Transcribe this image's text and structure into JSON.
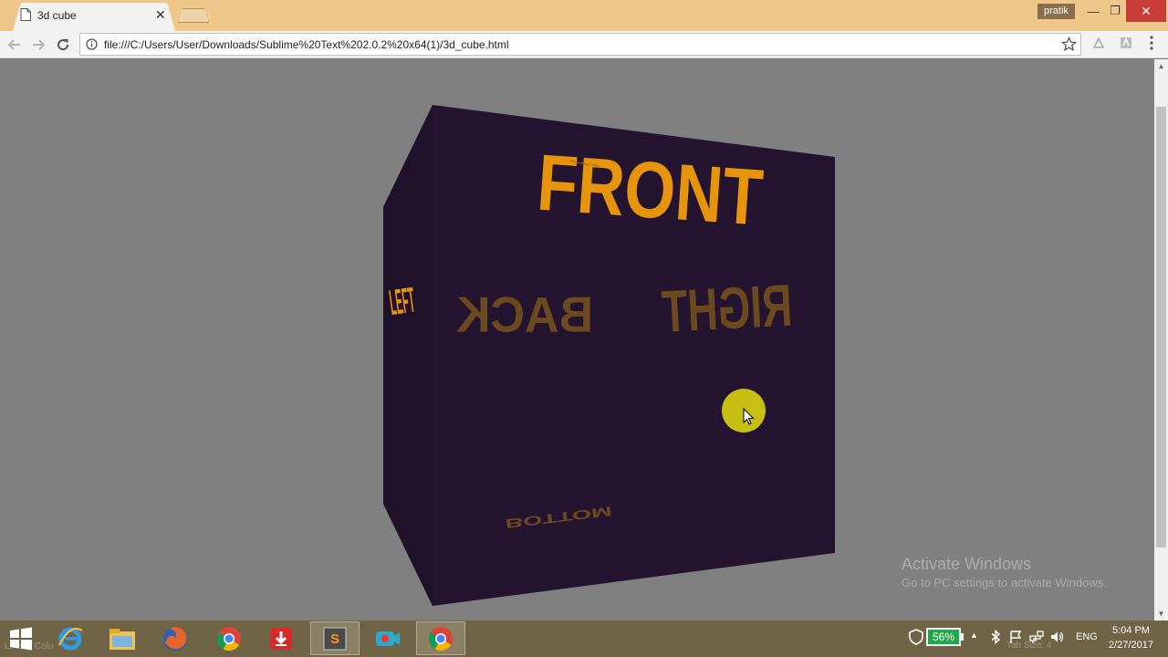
{
  "browser": {
    "tab_title": "3d cube",
    "tab_close_glyph": "✕",
    "profile_name": "pratik",
    "url": "file:///C:/Users/User/Downloads/Sublime%20Text%202.0.2%20x64(1)/3d_cube.html",
    "window_buttons": {
      "minimize": "—",
      "restore": "❐",
      "close": "✕"
    }
  },
  "cube": {
    "face_color": "#24142f",
    "front_label": "FRONT",
    "back_label": "BACK",
    "left_label": "LEFT",
    "right_label": "RIGHT",
    "bottom_label": "BOTTOM",
    "text_color": "#e5940b",
    "faded_text_color": "#6b4a1f"
  },
  "cursor_highlight_color": "#c7bf14",
  "watermark": {
    "title": "Activate Windows",
    "subtitle": "Go to PC settings to activate Windows."
  },
  "taskbar": {
    "faint_left": "Line 1, Colu",
    "faint_right": "Tab Size: 4",
    "battery_percent": "56%",
    "language": "ENG",
    "time": "5:04 PM",
    "date": "2/27/2017",
    "apps": [
      "windows-start-icon",
      "internet-explorer-icon",
      "file-explorer-icon",
      "firefox-icon",
      "chrome-icon",
      "download-manager-icon",
      "sublime-text-icon",
      "screen-recorder-icon",
      "chrome-icon"
    ]
  }
}
